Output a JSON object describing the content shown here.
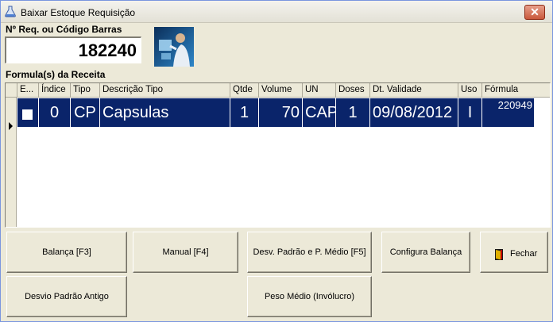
{
  "window": {
    "title": "Baixar Estoque Requisição",
    "close_symbol": "✕"
  },
  "request": {
    "label": "Nº Req. ou Código Barras",
    "value": "182240"
  },
  "formulas": {
    "label": "Formula(s) da Receita",
    "columns": [
      "E...",
      "Índice",
      "Tipo",
      "Descrição Tipo",
      "Qtde",
      "Volume",
      "UN",
      "Doses",
      "Dt. Validade",
      "Uso",
      "Fórmula"
    ],
    "rows": [
      {
        "selected": true,
        "checked": false,
        "indice": "0",
        "tipo": "CP",
        "descricao": "Capsulas",
        "qtde": "1",
        "volume": "70",
        "un": "CAP",
        "doses": "1",
        "validade": "09/08/2012",
        "uso": "I",
        "formula": "220949"
      }
    ]
  },
  "buttons": {
    "balanca": "Balança [F3]",
    "manual": "Manual [F4]",
    "desv_padrao": "Desv. Padrão e P. Médio [F5]",
    "configura": "Configura Balança",
    "fechar": "Fechar",
    "desvio_antigo": "Desvio Padrão Antigo",
    "peso_medio": "Peso Médio (Invólucro)"
  },
  "icons": {
    "title": "flask-icon",
    "photo": "user-touchscreen-image",
    "fechar": "exit-door-icon"
  }
}
